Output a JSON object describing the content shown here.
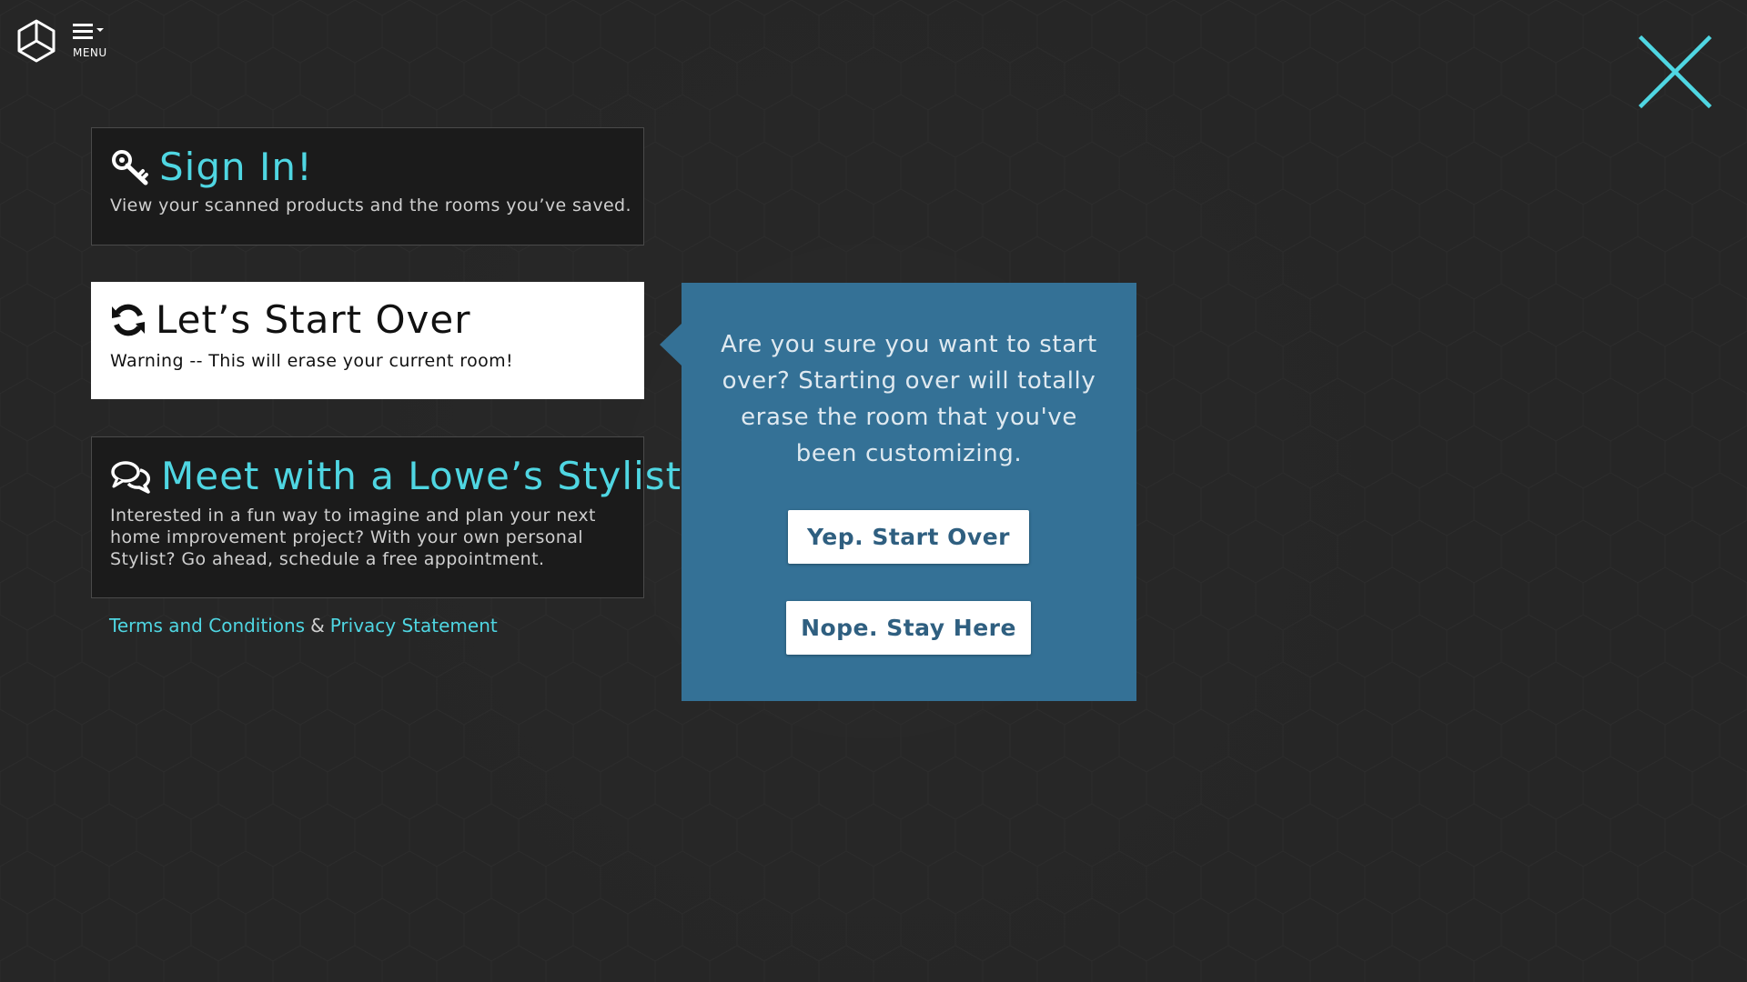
{
  "header": {
    "menu_label": "MENU",
    "logo_icon": "cube-logo-icon",
    "menu_icon": "hamburger-dropdown-icon",
    "close_icon": "close-x-icon"
  },
  "cards": {
    "signin": {
      "icon": "key-icon",
      "title": "Sign In!",
      "description": "View your scanned products and the rooms you’ve saved."
    },
    "startover": {
      "icon": "refresh-icon",
      "title": "Let’s Start Over",
      "description": "Warning -- This will erase your current room!"
    },
    "stylist": {
      "icon": "chat-bubbles-icon",
      "title": "Meet with a Lowe’s Stylist",
      "description": "Interested in a fun way to imagine and plan your next home improvement project? With your own personal Stylist? Go ahead, schedule a free appointment."
    }
  },
  "legal": {
    "terms": "Terms and Conditions",
    "amp": "&",
    "privacy": "Privacy Statement"
  },
  "confirm": {
    "message": "Are you sure you want to start over? Starting over will totally erase the room that you've been customizing.",
    "yes_label": "Yep. Start Over",
    "no_label": "Nope. Stay Here"
  },
  "colors": {
    "background": "#262626",
    "accent": "#4fd6e2",
    "popover": "#347196",
    "card_dark": "#1b1b1b",
    "card_active": "#ffffff"
  }
}
